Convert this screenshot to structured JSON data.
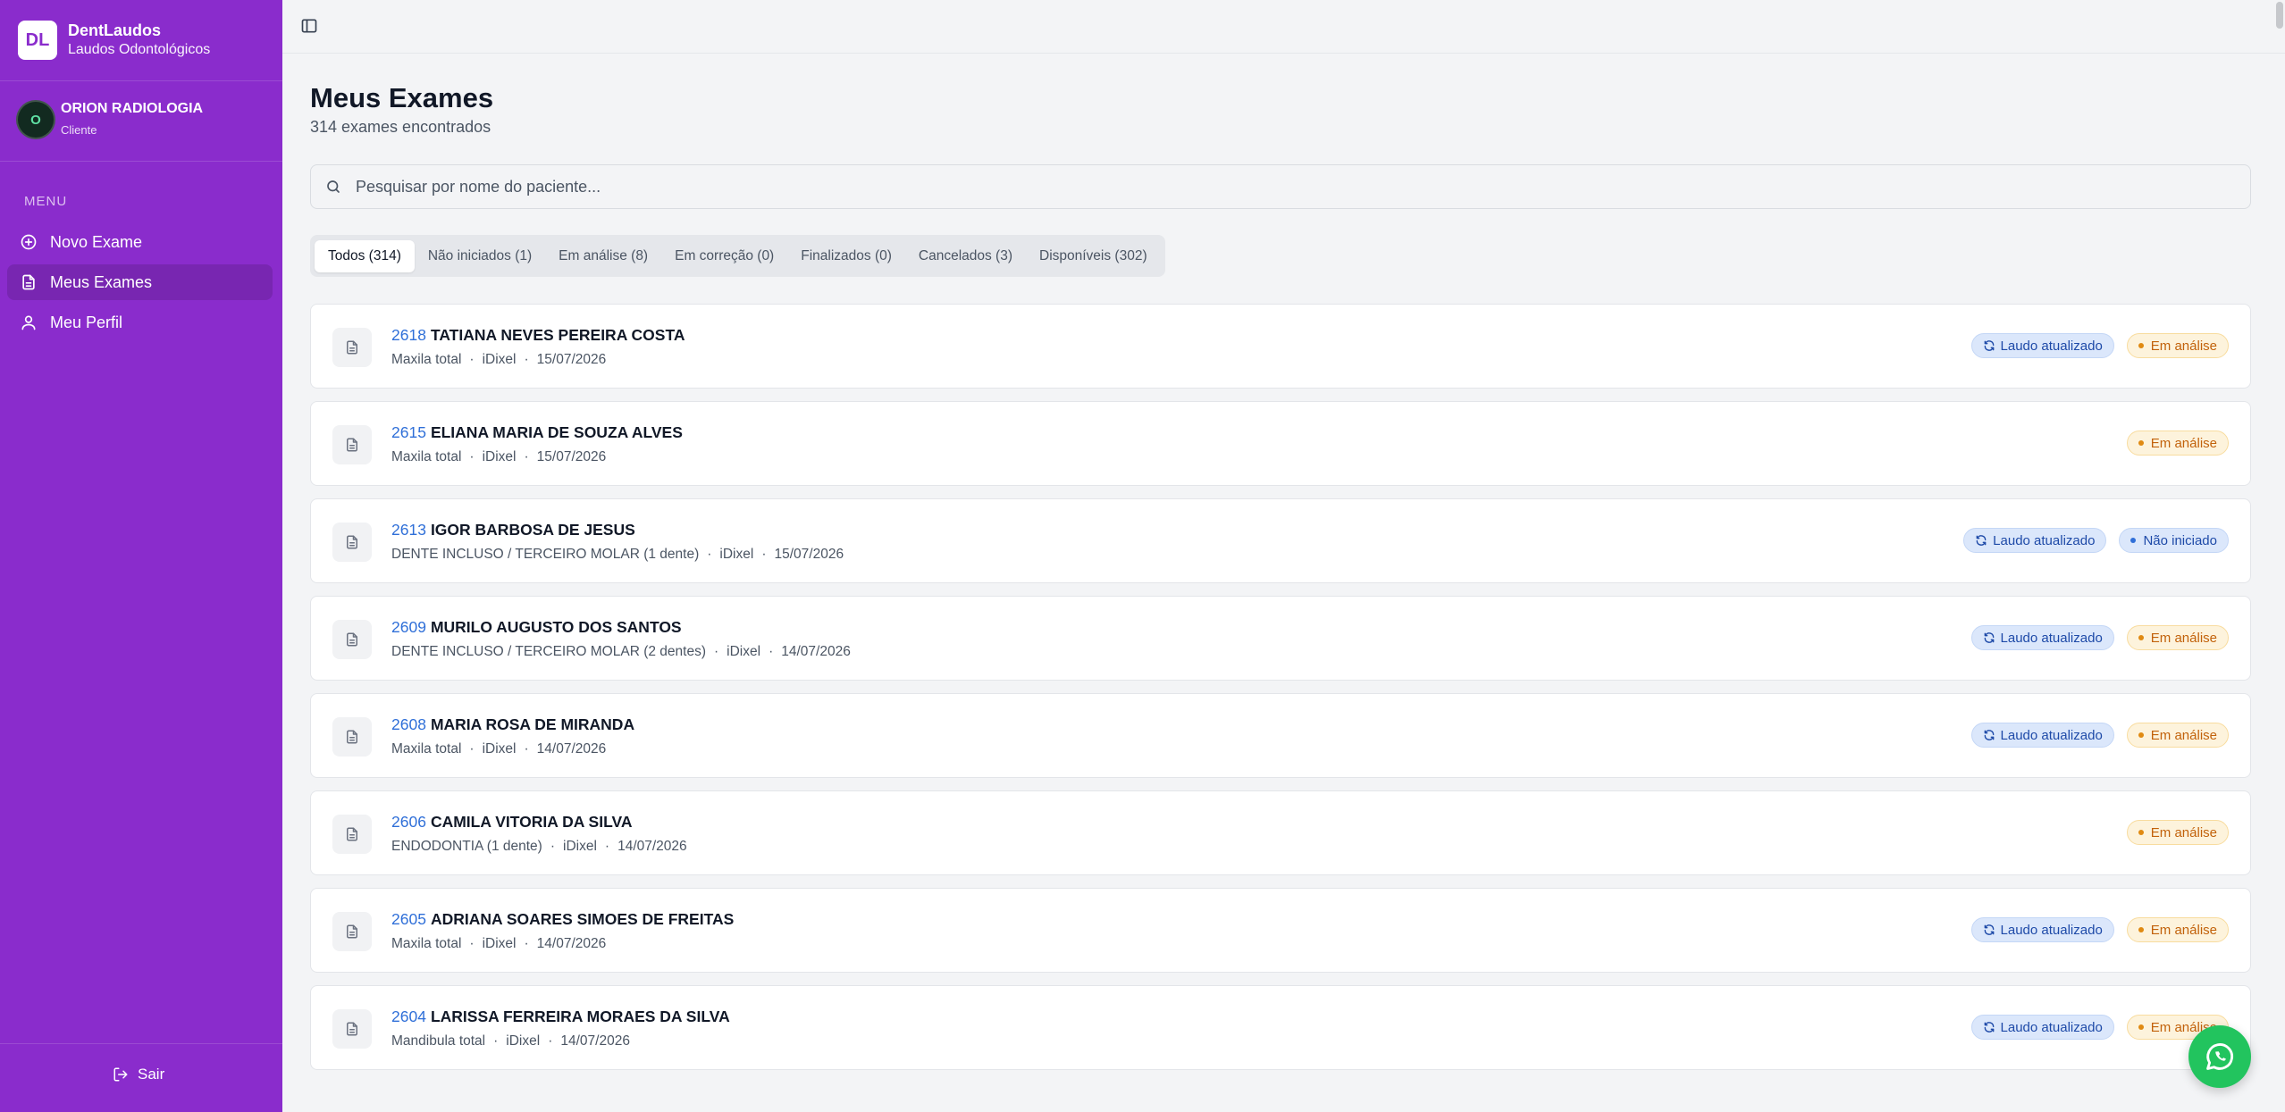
{
  "brand": {
    "logo": "DL",
    "name": "DentLaudos",
    "subtitle": "Laudos Odontológicos"
  },
  "user": {
    "initial": "O",
    "name": "ORION RADIOLOGIA",
    "role": "Cliente"
  },
  "sidebar": {
    "menu_label": "MENU",
    "items": [
      {
        "label": "Novo Exame",
        "icon": "plus-circle-icon",
        "active": false
      },
      {
        "label": "Meus Exames",
        "icon": "document-icon",
        "active": true
      },
      {
        "label": "Meu Perfil",
        "icon": "user-icon",
        "active": false
      }
    ],
    "logout_label": "Sair"
  },
  "page": {
    "title": "Meus Exames",
    "subtitle": "314 exames encontrados"
  },
  "search": {
    "placeholder": "Pesquisar por nome do paciente...",
    "value": ""
  },
  "tabs": [
    {
      "label": "Todos (314)",
      "active": true
    },
    {
      "label": "Não iniciados (1)",
      "active": false
    },
    {
      "label": "Em análise (8)",
      "active": false
    },
    {
      "label": "Em correção (0)",
      "active": false
    },
    {
      "label": "Finalizados (0)",
      "active": false
    },
    {
      "label": "Cancelados (3)",
      "active": false
    },
    {
      "label": "Disponíveis (302)",
      "active": false
    }
  ],
  "exams": [
    {
      "id": "2618",
      "patient": "TATIANA NEVES PEREIRA COSTA",
      "type": "Maxila total",
      "device": "iDixel",
      "date": "15/07/2026",
      "updated": "Laudo atualizado",
      "status": "Em análise",
      "status_kind": "analysis"
    },
    {
      "id": "2615",
      "patient": "ELIANA MARIA DE SOUZA ALVES",
      "type": "Maxila total",
      "device": "iDixel",
      "date": "15/07/2026",
      "updated": null,
      "status": "Em análise",
      "status_kind": "analysis"
    },
    {
      "id": "2613",
      "patient": "IGOR BARBOSA DE JESUS",
      "type": "DENTE INCLUSO / TERCEIRO MOLAR (1 dente)",
      "device": "iDixel",
      "date": "15/07/2026",
      "updated": "Laudo atualizado",
      "status": "Não iniciado",
      "status_kind": "notstarted"
    },
    {
      "id": "2609",
      "patient": "MURILO AUGUSTO DOS SANTOS",
      "type": "DENTE INCLUSO / TERCEIRO MOLAR (2 dentes)",
      "device": "iDixel",
      "date": "14/07/2026",
      "updated": "Laudo atualizado",
      "status": "Em análise",
      "status_kind": "analysis"
    },
    {
      "id": "2608",
      "patient": "MARIA ROSA DE MIRANDA",
      "type": "Maxila total",
      "device": "iDixel",
      "date": "14/07/2026",
      "updated": "Laudo atualizado",
      "status": "Em análise",
      "status_kind": "analysis"
    },
    {
      "id": "2606",
      "patient": "CAMILA VITORIA DA SILVA",
      "type": "ENDODONTIA (1 dente)",
      "device": "iDixel",
      "date": "14/07/2026",
      "updated": null,
      "status": "Em análise",
      "status_kind": "analysis"
    },
    {
      "id": "2605",
      "patient": "ADRIANA SOARES SIMOES DE FREITAS",
      "type": "Maxila total",
      "device": "iDixel",
      "date": "14/07/2026",
      "updated": "Laudo atualizado",
      "status": "Em análise",
      "status_kind": "analysis"
    },
    {
      "id": "2604",
      "patient": "LARISSA FERREIRA MORAES DA SILVA",
      "type": "Mandibula total",
      "device": "iDixel",
      "date": "14/07/2026",
      "updated": "Laudo atualizado",
      "status": "Em análise",
      "status_kind": "analysis"
    }
  ],
  "colors": {
    "sidebar": "#8a2ccc",
    "accent_blue": "#2f6fd8",
    "analysis": "#c2620b",
    "whatsapp": "#22c45e"
  }
}
